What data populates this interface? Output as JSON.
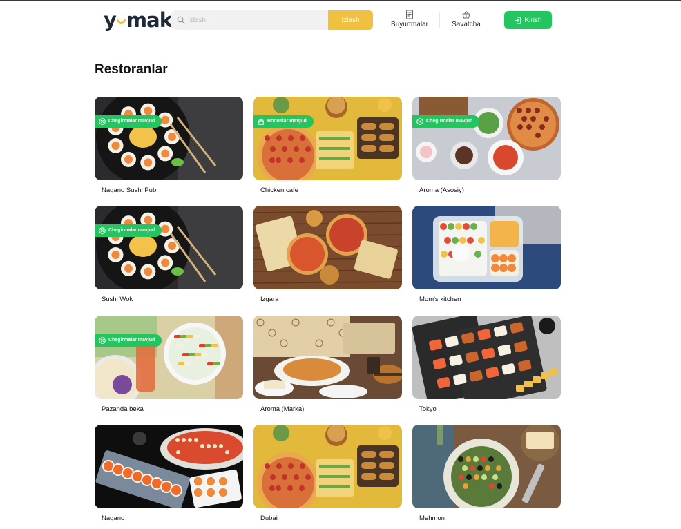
{
  "header": {
    "logo": "yemak",
    "search_placeholder": "Izlash",
    "search_button": "Izlash",
    "nav": {
      "orders": "Buyurtmalar",
      "cart": "Savatcha"
    },
    "login": "Kirish"
  },
  "page_title": "Restoranlar",
  "restaurants": [
    {
      "name": "Nagano Sushi Pub",
      "badge": "Chegirmalar mavjud",
      "badge_icon": "percent-icon",
      "theme": "sushi-dark"
    },
    {
      "name": "Chicken cafe",
      "badge": "Bonuslar mavjud",
      "badge_icon": "gift-icon",
      "theme": "pizza-yellow"
    },
    {
      "name": "Aroma (Asosiy)",
      "badge": "Chegirmalar mavjud",
      "badge_icon": "percent-icon",
      "theme": "table-grey"
    },
    {
      "name": "Sushi Wok",
      "badge": "Chegirmalar mavjud",
      "badge_icon": "percent-icon",
      "theme": "sushi-dark"
    },
    {
      "name": "Izgara",
      "badge": "",
      "badge_icon": "",
      "theme": "pizza-wood"
    },
    {
      "name": "Mom's kitchen",
      "badge": "",
      "badge_icon": "",
      "theme": "lunchbox-blue"
    },
    {
      "name": "Pazanda beka",
      "badge": "Chegirmalar mavjud",
      "badge_icon": "percent-icon",
      "theme": "salad-green"
    },
    {
      "name": "Aroma (Marka)",
      "badge": "",
      "badge_icon": "",
      "theme": "pizza-box"
    },
    {
      "name": "Tokyo",
      "badge": "",
      "badge_icon": "",
      "theme": "sushi-grey"
    },
    {
      "name": "Nagano",
      "badge": "",
      "badge_icon": "",
      "theme": "sushi-black"
    },
    {
      "name": "Dubai",
      "badge": "",
      "badge_icon": "",
      "theme": "pizza-yellow"
    },
    {
      "name": "Mehmon",
      "badge": "",
      "badge_icon": "",
      "theme": "salad-wood"
    }
  ],
  "colors": {
    "brand_green": "#22c55e",
    "search_yellow": "#f0c040",
    "logo_dark": "#1f2937",
    "logo_eye": "#f0c040"
  }
}
